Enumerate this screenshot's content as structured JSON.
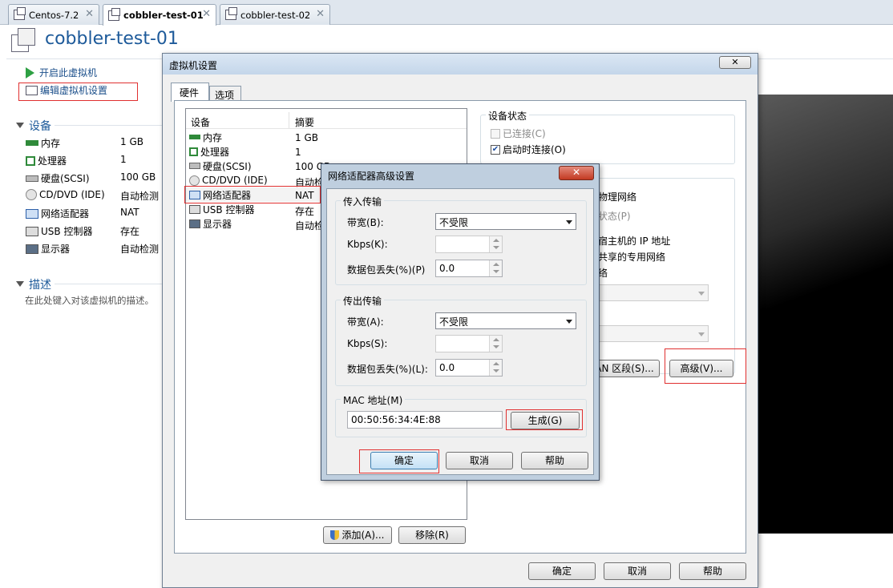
{
  "tabs": [
    {
      "label": "Centos-7.2"
    },
    {
      "label": "cobbler-test-01"
    },
    {
      "label": "cobbler-test-02"
    }
  ],
  "header": {
    "title": "cobbler-test-01"
  },
  "actions": {
    "power_on": "开启此虚拟机",
    "edit_settings": "编辑虚拟机设置"
  },
  "devices_section": {
    "title": "设备",
    "items": [
      {
        "name": "内存",
        "value": "1 GB",
        "icon": "memory-icon"
      },
      {
        "name": "处理器",
        "value": "1",
        "icon": "cpu-icon"
      },
      {
        "name": "硬盘(SCSI)",
        "value": "100 GB",
        "icon": "hdd-icon"
      },
      {
        "name": "CD/DVD (IDE)",
        "value": "自动检测",
        "icon": "cd-icon"
      },
      {
        "name": "网络适配器",
        "value": "NAT",
        "icon": "network-icon"
      },
      {
        "name": "USB 控制器",
        "value": "存在",
        "icon": "usb-icon"
      },
      {
        "name": "显示器",
        "value": "自动检测",
        "icon": "monitor-icon"
      }
    ]
  },
  "description_section": {
    "title": "描述",
    "placeholder": "在此处键入对该虚拟机的描述。"
  },
  "vm_settings": {
    "title": "虚拟机设置",
    "tabs": [
      "硬件",
      "选项"
    ],
    "columns": {
      "device": "设备",
      "summary": "摘要"
    },
    "rows": [
      {
        "name": "内存",
        "value": "1 GB"
      },
      {
        "name": "处理器",
        "value": "1"
      },
      {
        "name": "硬盘(SCSI)",
        "value": "100 GB"
      },
      {
        "name": "CD/DVD (IDE)",
        "value": "自动检"
      },
      {
        "name": "网络适配器",
        "value": "NAT"
      },
      {
        "name": "USB 控制器",
        "value": "存在"
      },
      {
        "name": "显示器",
        "value": "自动检"
      }
    ],
    "device_status": {
      "title": "设备状态",
      "connected": "已连接(C)",
      "connect_on_power": "启动时连接(O)",
      "connected_checked": false,
      "connect_on_power_checked": true
    },
    "partial": {
      "physical_net": "物理网络",
      "state": "状态(P)",
      "host_ip": "宿主机的 IP 地址",
      "shared_net": "共享的专用网络",
      "net": "络"
    },
    "lan_segment": "AN 区段(S)...",
    "advanced": "高级(V)...",
    "add": "添加(A)...",
    "remove": "移除(R)",
    "ok": "确定",
    "cancel": "取消",
    "help": "帮助"
  },
  "adv_dialog": {
    "title": "网络适配器高级设置",
    "incoming": {
      "title": "传入传输",
      "bandwidth_label": "带宽(B):",
      "bandwidth_value": "不受限",
      "kbps_label": "Kbps(K):",
      "kbps_value": "",
      "loss_label": "数据包丢失(%)(P)",
      "loss_value": "0.0"
    },
    "outgoing": {
      "title": "传出传输",
      "bandwidth_label": "带宽(A):",
      "bandwidth_value": "不受限",
      "kbps_label": "Kbps(S):",
      "kbps_value": "",
      "loss_label": "数据包丢失(%)(L):",
      "loss_value": "0.0"
    },
    "mac": {
      "title": "MAC 地址(M)",
      "value": "00:50:56:34:4E:88",
      "generate": "生成(G)"
    },
    "ok": "确定",
    "cancel": "取消",
    "help": "帮助"
  }
}
